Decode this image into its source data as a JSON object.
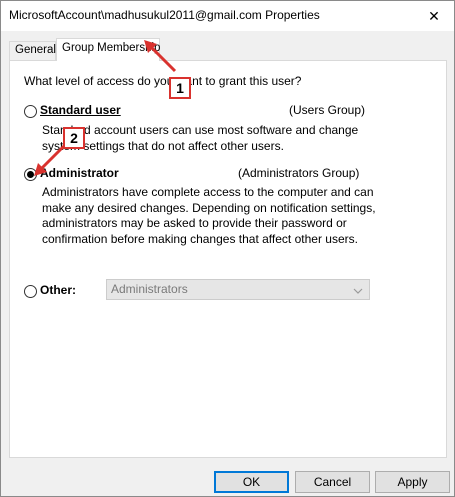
{
  "window": {
    "title": "MicrosoftAccount\\madhusukul2011@gmail.com Properties",
    "close_glyph": "✕"
  },
  "tabs": [
    {
      "label": "General",
      "active": false
    },
    {
      "label": "Group Membership",
      "active": true
    }
  ],
  "panel": {
    "question": "What level of access do you want to grant this user?",
    "options": [
      {
        "label": "Standard user",
        "group": "(Users Group)",
        "selected": false,
        "description": "Standard account users can use most software and change system settings that do not affect other users."
      },
      {
        "label": "Administrator",
        "group": "(Administrators Group)",
        "selected": true,
        "description": "Administrators have complete access to the computer and can make any desired changes. Depending on notification settings, administrators may be asked to provide their password or confirmation before making changes that affect other users."
      },
      {
        "label": "Other:",
        "selected": false,
        "select_value": "Administrators"
      }
    ]
  },
  "buttons": {
    "ok": "OK",
    "cancel": "Cancel",
    "apply": "Apply"
  },
  "annotations": {
    "step1": "1",
    "step2": "2",
    "color": "#d9322e"
  },
  "colors": {
    "accent": "#0078d7",
    "window_bg": "#f0f0f0",
    "panel_bg": "#ffffff"
  }
}
